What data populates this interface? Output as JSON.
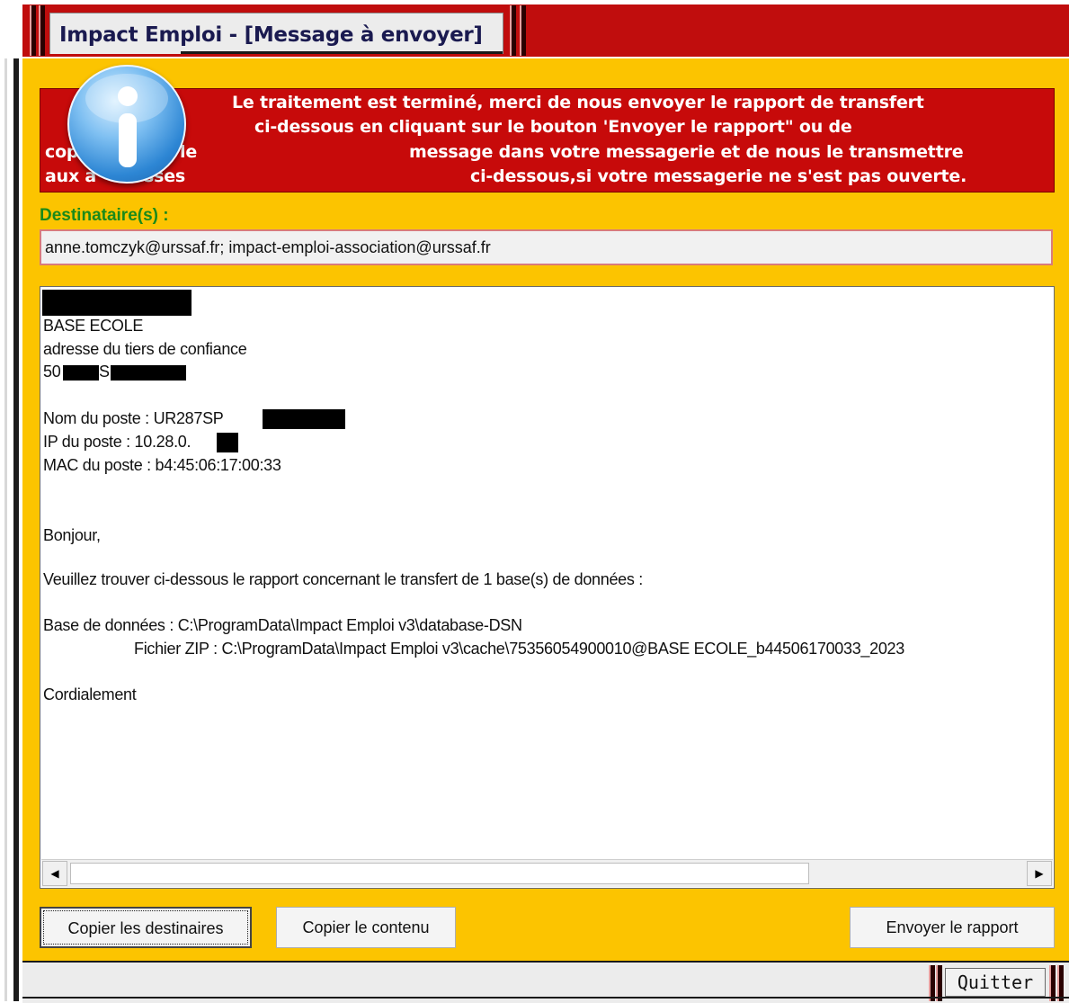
{
  "window": {
    "title": "Impact Emploi - [Message à envoyer]"
  },
  "banner": {
    "lines": [
      "Le traitement est terminé, merci de nous envoyer le rapport de transfert",
      "ci-dessous en cliquant sur le bouton 'Envoyer le rapport\" ou de",
      "copier le message dans votre messagerie et de nous le transmettre",
      "aux adresses ci-dessous,si votre messagerie ne s'est pas ouverte."
    ],
    "visible_fragments": {
      "left_line3": "cop",
      "left_line3b": "le",
      "left_line4": "aux a",
      "left_line4b": "sses",
      "line3_right": "message dans votre messagerie et de nous le transmettre",
      "line4_right": "ci-dessous,si votre messagerie ne s'est pas ouverte."
    },
    "icon": "info-icon",
    "background_color": "#c70a0a"
  },
  "recipients": {
    "label": "Destinataire(s) :",
    "value": "anne.tomczyk@urssaf.fr; impact-emploi-association@urssaf.fr"
  },
  "message": {
    "org": "BASE ECOLE",
    "address": "adresse du tiers de confiance",
    "city_prefix": "50",
    "city_letter": "S",
    "poste_name": "Nom du poste : UR287SP",
    "poste_ip": "IP du poste : 10.28.0.",
    "poste_mac": "MAC du poste : b4:45:06:17:00:33",
    "greeting": "Bonjour,",
    "intro": "Veuillez trouver ci-dessous le rapport concernant le transfert de 1 base(s) de données :",
    "db_line": "Base de données : C:\\ProgramData\\Impact Emploi v3\\database-DSN",
    "zip_line": "Fichier ZIP : C:\\ProgramData\\Impact Emploi v3\\cache\\75356054900010@BASE ECOLE_b44506170033_2023",
    "closing": "Cordialement"
  },
  "buttons": {
    "copy_recipients": "Copier les destinaires",
    "copy_content": "Copier le contenu",
    "send_report": "Envoyer le rapport",
    "quit": "Quitter"
  },
  "colors": {
    "dialog_background": "#fcc400",
    "title_bar": "#c00d0d",
    "label_green": "#1a8a1a"
  }
}
